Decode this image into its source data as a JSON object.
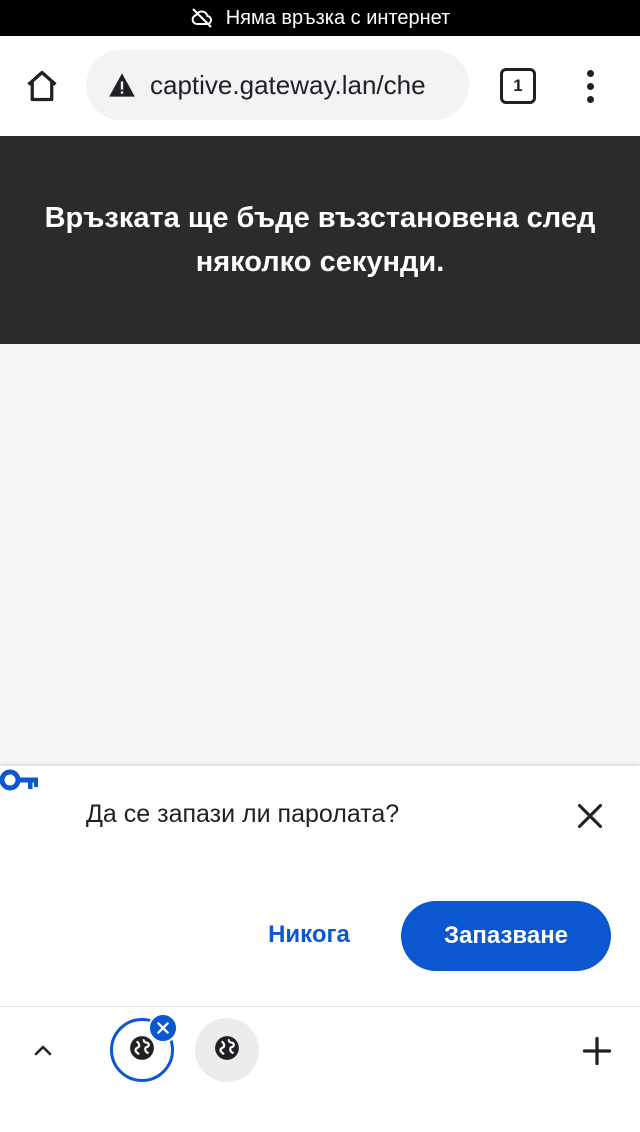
{
  "status_bar": {
    "icon": "cloud-off-icon",
    "text": "Няма връзка с интернет"
  },
  "toolbar": {
    "home_icon": "home-icon",
    "security_icon": "warning-triangle-icon",
    "url": "captive.gateway.lan/che",
    "tab_count": "1",
    "menu_icon": "more-vert-icon"
  },
  "page": {
    "banner_text": "Връзката ще бъде възстановена след няколко секунди."
  },
  "save_password": {
    "icon": "key-icon",
    "title": "Да се запази ли паролата?",
    "close_icon": "close-icon",
    "never_label": "Никога",
    "save_label": "Запазване",
    "accent": "#0b57d0"
  },
  "tab_strip": {
    "expand_icon": "chevron-up-icon",
    "tabs": [
      {
        "icon": "globe-icon",
        "active": true
      },
      {
        "icon": "globe-icon",
        "active": false
      }
    ],
    "new_tab_icon": "plus-icon"
  }
}
